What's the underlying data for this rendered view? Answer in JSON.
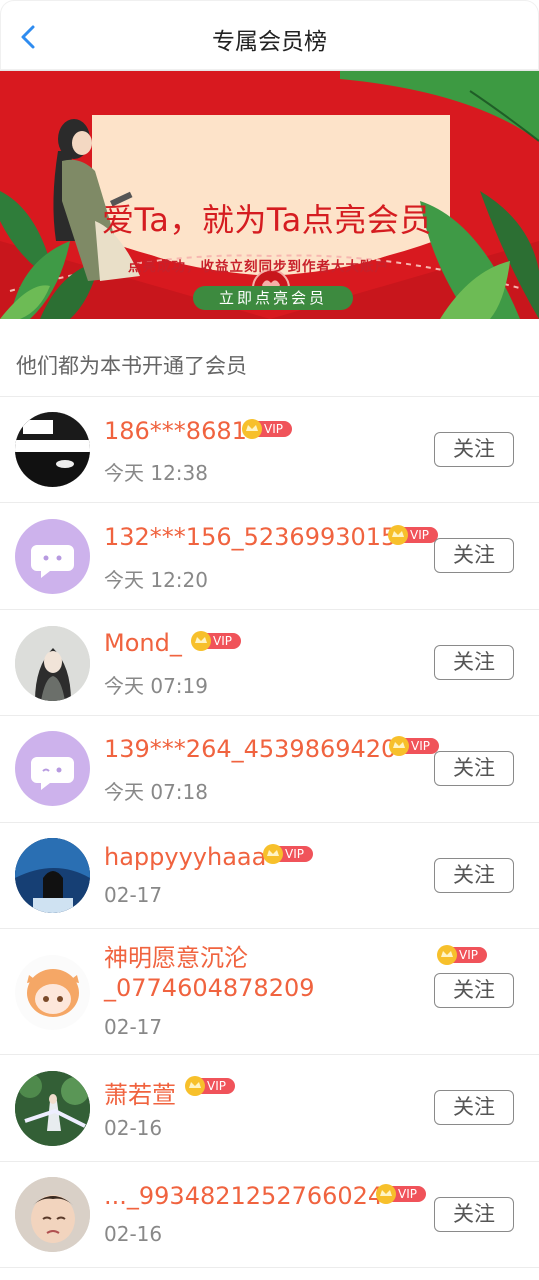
{
  "header": {
    "title": "专属会员榜"
  },
  "banner": {
    "headline": "爱Ta，就为Ta点亮会员",
    "subline": "点亮成功，收益立刻同步到作者大大账户",
    "cta": "立即点亮会员"
  },
  "section_title": "他们都为本书开通了会员",
  "vip_label": "VIP",
  "follow_label": "关注",
  "members": [
    {
      "name": "186***8681",
      "time": "今天 12:38"
    },
    {
      "name": "132***156_5236993015",
      "time": "今天 12:20"
    },
    {
      "name": "Mond_",
      "time": "今天 07:19"
    },
    {
      "name": "139***264_4539869420",
      "time": "今天 07:18"
    },
    {
      "name": "happyyyhaaa",
      "time": "02-17"
    },
    {
      "name": "神明愿意沉沦\n_0774604878209",
      "time": "02-17"
    },
    {
      "name": "萧若萱",
      "time": "02-16"
    },
    {
      "name": "..._9934821252766024",
      "time": "02-16"
    }
  ]
}
